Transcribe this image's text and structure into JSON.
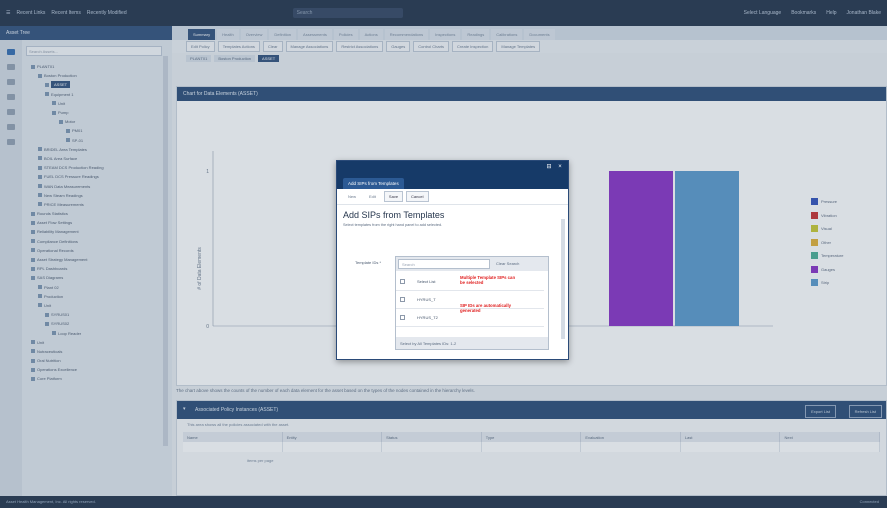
{
  "topbar": {
    "items": [
      "Recent Links",
      "Recent Items",
      "Recently Modified"
    ],
    "search_placeholder": "Search",
    "right_items": [
      "Select Language",
      "Bookmarks",
      "Help",
      "Jonathan Blake"
    ]
  },
  "left_panel": {
    "header": "Asset Tree",
    "filter_placeholder": "Search Assets...",
    "tree": [
      {
        "label": "PLANT01",
        "depth": 1
      },
      {
        "label": "Boston Production",
        "depth": 2
      },
      {
        "label": "ASSET",
        "depth": 3,
        "selected": true
      },
      {
        "label": "Equipment 1",
        "depth": 3
      },
      {
        "label": "Unit",
        "depth": 4
      },
      {
        "label": "Pump",
        "depth": 4
      },
      {
        "label": "Motor",
        "depth": 5
      },
      {
        "label": "PM01",
        "depth": 6
      },
      {
        "label": "SP-01",
        "depth": 6
      },
      {
        "label": "BRIDEL Area Templates",
        "depth": 2
      },
      {
        "label": "BOIL Area Surface",
        "depth": 2
      },
      {
        "label": "STEAM DCS Production Reading",
        "depth": 2
      },
      {
        "label": "FUEL DCS Pressure Readings",
        "depth": 2
      },
      {
        "label": "WAN Data Measurements",
        "depth": 2
      },
      {
        "label": "New Steam Readings",
        "depth": 2
      },
      {
        "label": "PRICE Measurements",
        "depth": 2
      },
      {
        "label": "Rounds Statistics",
        "depth": 1
      },
      {
        "label": "Asset Flow Settings",
        "depth": 1
      },
      {
        "label": "Reliability Management",
        "depth": 1
      },
      {
        "label": "Compliance Definitions",
        "depth": 1
      },
      {
        "label": "Operational Records",
        "depth": 1
      },
      {
        "label": "Asset Strategy Management",
        "depth": 1
      },
      {
        "label": "RPL Dashboards",
        "depth": 1
      },
      {
        "label": "SAS Diagrams",
        "depth": 1
      },
      {
        "label": "Plant 02",
        "depth": 2
      },
      {
        "label": "Production",
        "depth": 2
      },
      {
        "label": "Unit",
        "depth": 2
      },
      {
        "label": "SYRUS01",
        "depth": 3
      },
      {
        "label": "SYRUS02",
        "depth": 3
      },
      {
        "label": "Loop Reader",
        "depth": 4
      },
      {
        "label": "Unit",
        "depth": 1
      },
      {
        "label": "Nutraceuticals",
        "depth": 1
      },
      {
        "label": "Oral Nutrition",
        "depth": 1
      },
      {
        "label": "Operations Excellence",
        "depth": 1
      },
      {
        "label": "Core Platform",
        "depth": 1
      }
    ]
  },
  "main": {
    "tabs": [
      "Summary",
      "Health",
      "Overview",
      "Definition",
      "Assessments",
      "Policies",
      "Actions",
      "Recommendations",
      "Inspections",
      "Readings",
      "Calibrations",
      "Documents"
    ],
    "active_tab": 0,
    "toolbar": [
      "Edit Policy",
      "Templates Actions",
      "Clear",
      "Manage Associations",
      "Restrict Associations",
      "Gauges",
      "Control Charts",
      "Create Inspection",
      "Manage Templates"
    ],
    "breadcrumbs": [
      "PLANT01",
      "Boston Production",
      "ASSET"
    ],
    "chart_panel_title": "Chart for Data Elements (ASSET)",
    "caption": "The chart above shows the counts of the number of each data element for the asset based on the types of the nodes contained in the hierarchy levels.",
    "subpanel_title": "Associated Policy Instances (ASSET)",
    "subpanel_buttons": [
      "Export List",
      "Refresh List"
    ],
    "subpanel_desc": "This area shows all the policies associated with the asset.",
    "grid_columns": [
      "Name",
      "Entity",
      "Status",
      "Type",
      "Evaluation",
      "Last",
      "Next"
    ],
    "pager": "items per page"
  },
  "chart_data": {
    "type": "bar",
    "title": "",
    "ylabel": "# of Data Elements",
    "ylim": [
      0,
      1
    ],
    "ytick": 1,
    "series": [
      {
        "name": "Gauges",
        "values": [
          1
        ],
        "color": "#7d1dc0"
      },
      {
        "name": "Strip",
        "values": [
          1
        ],
        "color": "#4a8fc6"
      }
    ],
    "legend": [
      {
        "name": "Pressure",
        "color": "#1c3fb3"
      },
      {
        "name": "Vibration",
        "color": "#c21a1a"
      },
      {
        "name": "Visual",
        "color": "#c4c41c"
      },
      {
        "name": "Other",
        "color": "#e0a820"
      },
      {
        "name": "Temperature",
        "color": "#3aa58a"
      },
      {
        "name": "Gauges",
        "color": "#7d1dc0"
      },
      {
        "name": "Strip",
        "color": "#4a8fc6"
      }
    ],
    "legend_position": "right"
  },
  "dialog": {
    "tab_label": "Add SIPs from Templates",
    "toolbar": [
      "New",
      "Edit",
      "Save",
      "Cancel"
    ],
    "heading": "Add SIPs from Templates",
    "instructions": "Select templates from the right hand panel to add selected.",
    "field_label": "Template IDs *",
    "search_placeholder": "Search",
    "clear_search": "Clear Search",
    "column_header": "Select List",
    "rows": [
      "HYRUS_T",
      "HYRUS_T2"
    ],
    "note1": "Multiple Template SIPs can be selected",
    "note2": "SIP IDs are automatically generated",
    "footer": "Select by All Templates IDs: 1-2"
  },
  "statusbar": {
    "left": "Asset Health Management, Inc. All rights reserved.",
    "right": "Connected"
  }
}
